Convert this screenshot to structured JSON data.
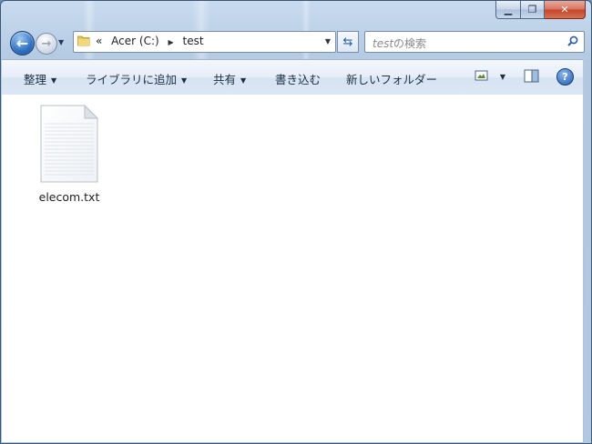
{
  "window": {
    "caption_buttons": {
      "minimize": "▁",
      "maximize": "❐",
      "close": "✕"
    }
  },
  "nav": {
    "address": {
      "overflow": "«",
      "crumbs": [
        "Acer (C:)",
        "test"
      ],
      "icon": "folder-icon"
    },
    "search": {
      "placeholder_term": "test",
      "placeholder_suffix": "の検索"
    }
  },
  "toolbar": {
    "organize": "整理",
    "include_library": "ライブラリに追加",
    "share": "共有",
    "burn": "書き込む",
    "new_folder": "新しいフォルダー",
    "help": "?"
  },
  "files": [
    {
      "name": "elecom.txt",
      "icon": "text-file-icon"
    }
  ],
  "colors": {
    "frame": "#a9c2de",
    "toolbar": "#dce7f4",
    "accent": "#2f6fc0"
  }
}
